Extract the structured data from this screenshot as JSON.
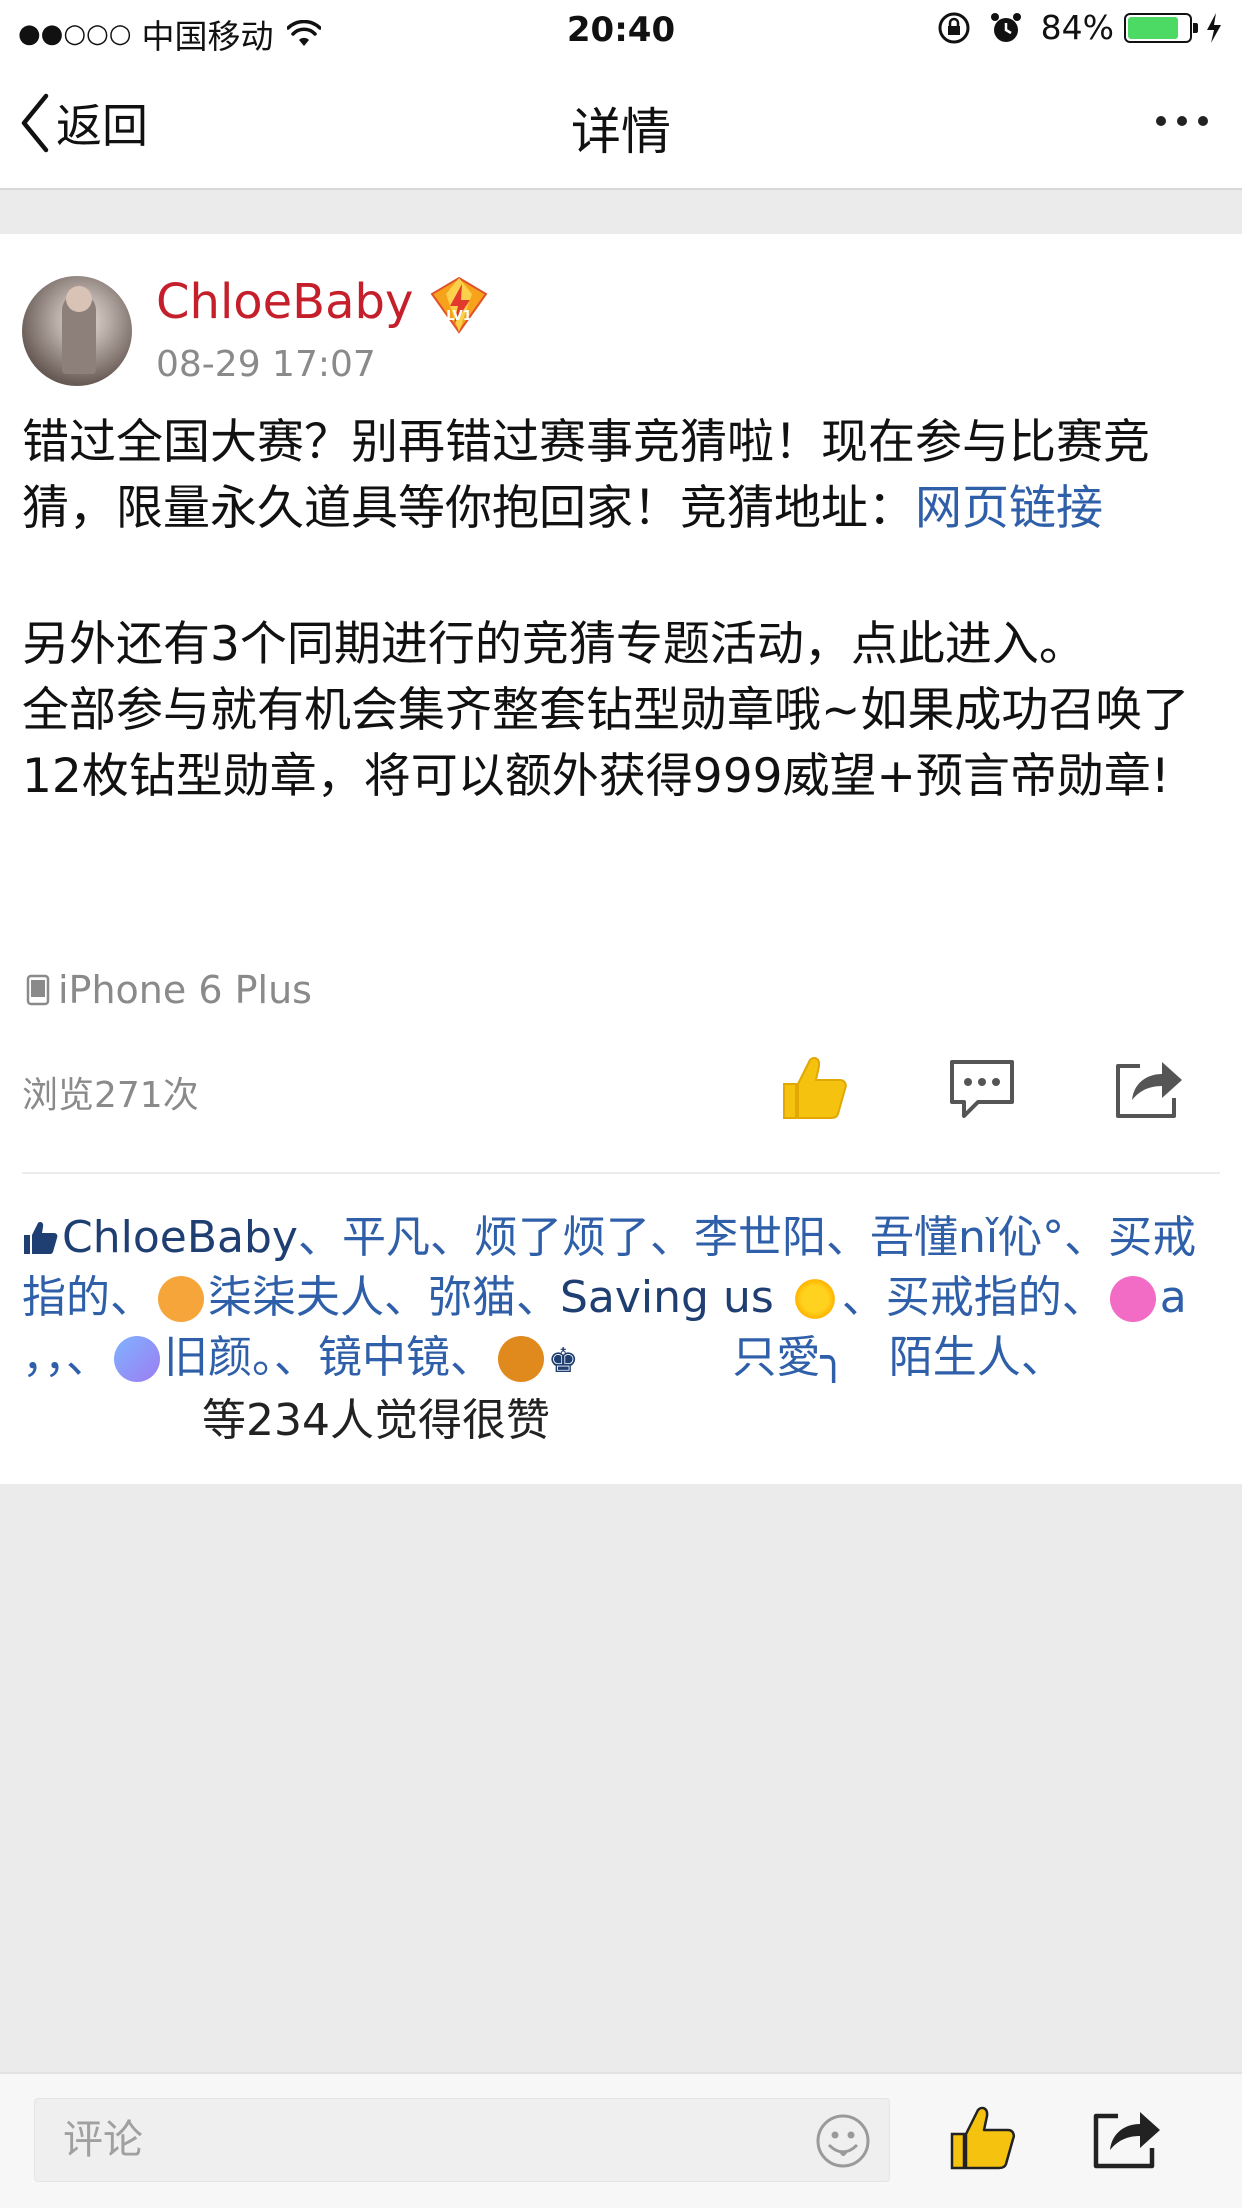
{
  "status_bar": {
    "signal_dots": "●●○○○",
    "carrier": "中国移动",
    "time": "20:40",
    "battery_percent": "84%",
    "battery_level": 0.84,
    "icons": [
      "wifi-icon",
      "rotation-lock-icon",
      "alarm-icon",
      "battery-icon",
      "charging-icon"
    ]
  },
  "nav": {
    "back_label": "返回",
    "title": "详情",
    "more_icon": "more-icon"
  },
  "post": {
    "username": "ChloeBaby",
    "level_badge": "LV1",
    "timestamp": "08-29 17:07",
    "para1_text": "错过全国大赛？别再错过赛事竞猜啦！现在参与比赛竞猜，限量永久道具等你抱回家！竞猜地址：",
    "para1_link": "网页链接",
    "para2_line1": "另外还有3个同期进行的竞猜专题活动，点此进入。",
    "para2_line2": "全部参与就有机会集齐整套钻型勋章哦~如果成功召唤了12枚钻型勋章，将可以额外获得999威望+预言帝勋章!",
    "device": "iPhone 6 Plus",
    "views": "浏览271次"
  },
  "likes": {
    "names": [
      "ChloeBaby",
      "平凡",
      "烦了烦了",
      "李世阳",
      "吾懂nǐ伈°",
      "买戒指的",
      "柒柒夫人",
      "弥猫",
      "Saving us",
      "买戒指的",
      "a",
      "，，",
      "旧颜。",
      "镜中镜",
      "♚",
      "只愛╮",
      "陌生人"
    ],
    "separator": "、",
    "summary": "等234人觉得很赞"
  },
  "bottom_bar": {
    "comment_placeholder": "评论"
  },
  "colors": {
    "username": "#c41f2a",
    "link": "#2e5fa8",
    "like_yellow": "#f5c30f",
    "battery_green": "#4cd964"
  }
}
